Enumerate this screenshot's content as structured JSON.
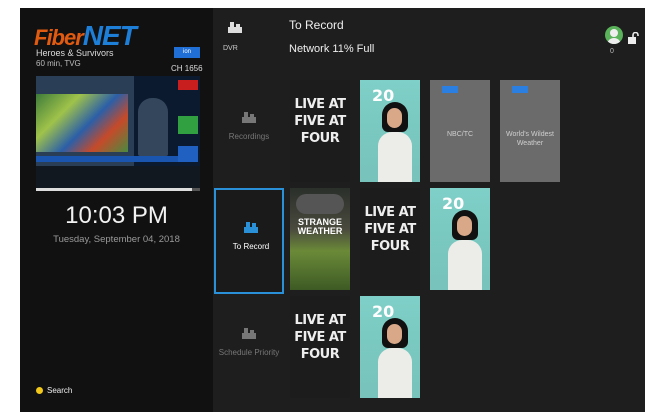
{
  "left_panel": {
    "logo_fiber": "Fiber",
    "logo_net": "NET",
    "program_title": "Heroes & Survivors",
    "program_meta": "60 min, TVG",
    "channel_logo": "ion",
    "channel_number": "CH 1656",
    "progress_fraction": 0.95,
    "time": "10:03 PM",
    "date": "Tuesday, September 04, 2018",
    "search_label": "Search"
  },
  "header": {
    "dvr_label": "DVR",
    "title": "To Record",
    "status": "Network 11% Full",
    "user_sub": "0"
  },
  "categories": [
    {
      "label": "Recordings",
      "selected": false
    },
    {
      "label": "To Record",
      "selected": true
    },
    {
      "label": "Schedule Priority",
      "selected": false
    }
  ],
  "rows": [
    {
      "tiles": [
        {
          "type": "live",
          "text": "LIVE AT FIVE AT FOUR"
        },
        {
          "type": "20",
          "text": "20"
        },
        {
          "type": "gray",
          "logo": "ion",
          "name": "NBC/TC"
        },
        {
          "type": "gray",
          "logo": "ion",
          "name": "World's Wildest Weather"
        }
      ]
    },
    {
      "tiles": [
        {
          "type": "storm",
          "text": "STRANGE WEATHER"
        },
        {
          "type": "live",
          "text": "LIVE AT FIVE AT FOUR"
        },
        {
          "type": "20",
          "text": "20"
        }
      ]
    },
    {
      "tiles": [
        {
          "type": "live",
          "text": "LIVE AT FIVE AT FOUR"
        },
        {
          "type": "20",
          "text": "20"
        }
      ]
    }
  ],
  "colors": {
    "selection_border": "#2a90d8",
    "search_dot": "#f2c81a",
    "accent_blue": "#1e7fd8"
  }
}
